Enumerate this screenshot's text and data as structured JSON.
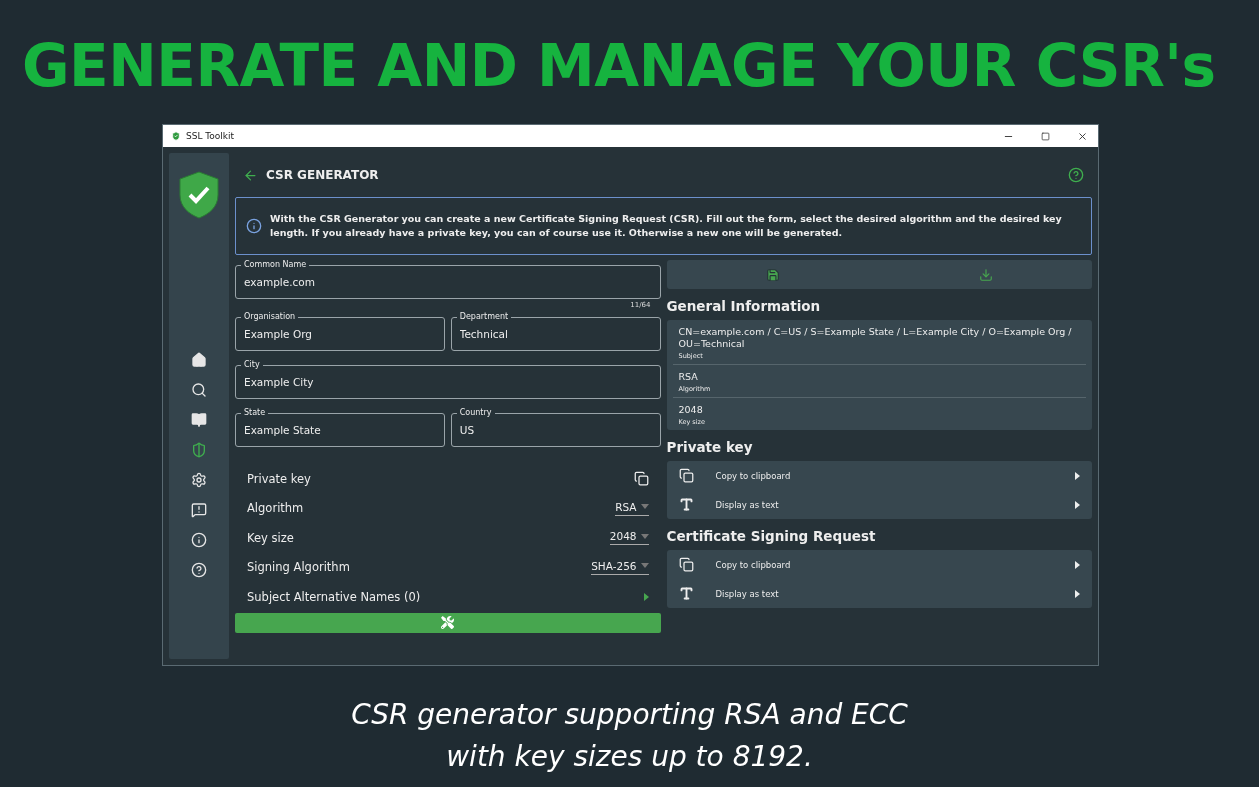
{
  "headline": "GENERATE AND MANAGE YOUR CSR's",
  "window": {
    "title": "SSL Toolkit"
  },
  "sidebar": {
    "items": [
      {
        "kind": "home",
        "selected": false
      },
      {
        "kind": "search",
        "selected": false
      },
      {
        "kind": "book",
        "selected": false
      },
      {
        "kind": "shield",
        "selected": true
      },
      {
        "kind": "settings",
        "selected": false
      },
      {
        "kind": "feedback",
        "selected": false
      },
      {
        "kind": "info",
        "selected": false
      },
      {
        "kind": "help",
        "selected": false
      }
    ]
  },
  "page": {
    "title": "CSR GENERATOR"
  },
  "info": "With the CSR Generator you can create a new Certificate Signing Request (CSR). Fill out the form, select the desired algorithm and the desired key length. If you already have a private key, you can of course use it. Otherwise a new one will be generated.",
  "form": {
    "rows": [
      [
        {
          "label": "Common Name",
          "value": "example.com"
        }
      ],
      [
        {
          "label": "Organisation",
          "value": "Example Org"
        },
        {
          "label": "Department",
          "value": "Technical"
        }
      ],
      [
        {
          "label": "City",
          "value": "Example City"
        }
      ],
      [
        {
          "label": "State",
          "value": "Example State"
        },
        {
          "label": "Country",
          "value": "US"
        }
      ]
    ],
    "counter": "11/64",
    "options": [
      {
        "kind": "copy",
        "label": "Private key"
      },
      {
        "kind": "select",
        "label": "Algorithm",
        "value": "RSA"
      },
      {
        "kind": "select",
        "label": "Key size",
        "value": "2048"
      },
      {
        "kind": "select",
        "label": "Signing Algorithm",
        "value": "SHA-256"
      },
      {
        "kind": "expand",
        "label": "Subject Alternative Names (0)"
      }
    ]
  },
  "general": {
    "title": "General Information",
    "rows": [
      {
        "value": "CN=example.com / C=US / S=Example State / L=Example City / O=Example Org / OU=Technical",
        "label": "Subject"
      },
      {
        "value": "RSA",
        "label": "Algorithm"
      },
      {
        "value": "2048",
        "label": "Key size"
      }
    ]
  },
  "sections": [
    {
      "title": "Private key",
      "actions": [
        {
          "kind": "copy",
          "label": "Copy to clipboard"
        },
        {
          "kind": "text",
          "label": "Display as text"
        }
      ]
    },
    {
      "title": "Certificate Signing Request",
      "actions": [
        {
          "kind": "copy",
          "label": "Copy to clipboard"
        },
        {
          "kind": "text",
          "label": "Display as text"
        }
      ]
    }
  ],
  "caption": [
    "CSR generator supporting RSA and ECC",
    "with key sizes up to 8192."
  ]
}
